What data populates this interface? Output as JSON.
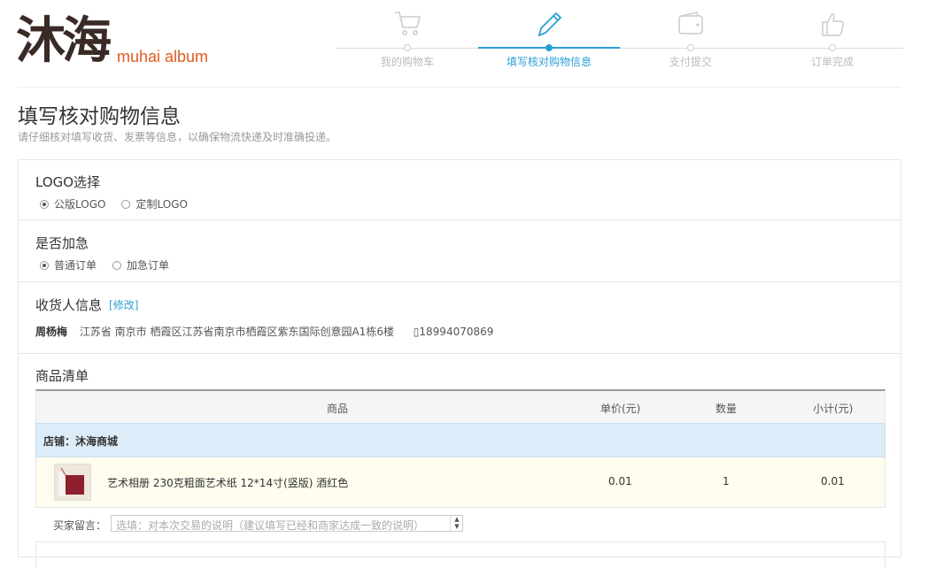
{
  "logo": {
    "cn": "沐海",
    "en": "muhai  album"
  },
  "steps": [
    {
      "label": "我的购物车",
      "icon": "cart-icon",
      "active": false
    },
    {
      "label": "填写核对购物信息",
      "icon": "pencil-icon",
      "active": true
    },
    {
      "label": "支付提交",
      "icon": "wallet-icon",
      "active": false
    },
    {
      "label": "订单完成",
      "icon": "thumbs-up-icon",
      "active": false
    }
  ],
  "page": {
    "title": "填写核对购物信息",
    "subtitle": "请仔细核对填写收货、发票等信息，以确保物流快递及时准确投递。"
  },
  "logo_section": {
    "title": "LOGO选择",
    "options": [
      {
        "label": "公版LOGO",
        "selected": true
      },
      {
        "label": "定制LOGO",
        "selected": false
      }
    ]
  },
  "urgent_section": {
    "title": "是否加急",
    "options": [
      {
        "label": "普通订单",
        "selected": true
      },
      {
        "label": "加急订单",
        "selected": false
      }
    ]
  },
  "receiver_section": {
    "title": "收货人信息",
    "modify": "[修改]",
    "name": "周杨梅",
    "address": "江苏省 南京市 栖霞区江苏省南京市栖霞区紫东国际创意园A1栋6楼",
    "phone": "18994070869",
    "phone_icon": "phone-icon"
  },
  "goods_section": {
    "title": "商品清单",
    "columns": {
      "product": "商品",
      "price": "单价(元)",
      "qty": "数量",
      "subtotal": "小计(元)"
    },
    "shop": "店铺：沐海商城",
    "items": [
      {
        "name": "艺术相册 230克粗面艺术纸 12*14寸(竖版) 酒红色",
        "price": "0.01",
        "qty": "1",
        "subtotal": "0.01"
      }
    ],
    "message_label": "买家留言：",
    "message_placeholder": "选填：对本次交易的说明（建议填写已经和商家达成一致的说明）"
  },
  "colors": {
    "accent": "#2a9fd6",
    "logo_en": "#e05a1e",
    "shop_row": "#dcecf8",
    "item_row": "#fffdee"
  }
}
